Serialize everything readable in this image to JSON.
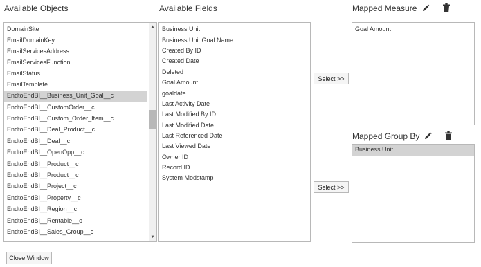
{
  "headers": {
    "available_objects": "Available Objects",
    "available_fields": "Available Fields",
    "mapped_measure": "Mapped Measure",
    "mapped_group_by": "Mapped Group By"
  },
  "objects": {
    "items": [
      "DomainSite",
      "EmailDomainKey",
      "EmailServicesAddress",
      "EmailServicesFunction",
      "EmailStatus",
      "EmailTemplate",
      "EndtoEndBI__Business_Unit_Goal__c",
      "EndtoEndBI__CustomOrder__c",
      "EndtoEndBI__Custom_Order_Item__c",
      "EndtoEndBI__Deal_Product__c",
      "EndtoEndBI__Deal__c",
      "EndtoEndBI__OpenOpp__c",
      "EndtoEndBI__Product__c",
      "EndtoEndBI__Product__c",
      "EndtoEndBI__Project__c",
      "EndtoEndBI__Property__c",
      "EndtoEndBI__Region__c",
      "EndtoEndBI__Rentable__c",
      "EndtoEndBI__Sales_Group__c"
    ],
    "selected_index": 6
  },
  "fields": {
    "items": [
      "Business Unit",
      "Business Unit Goal Name",
      "Created By ID",
      "Created Date",
      "Deleted",
      "Goal Amount",
      "goaldate",
      "Last Activity Date",
      "Last Modified By ID",
      "Last Modified Date",
      "Last Referenced Date",
      "Last Viewed Date",
      "Owner ID",
      "Record ID",
      "System Modstamp"
    ]
  },
  "measure": {
    "items": [
      "Goal Amount"
    ]
  },
  "group_by": {
    "items": [
      "Business Unit"
    ],
    "selected_index": 0
  },
  "buttons": {
    "select_measure": "Select >>",
    "select_group": "Select >>",
    "close_window": "Close Window"
  },
  "icons": {
    "measure_edit": "pencil-icon",
    "measure_delete": "trash-icon",
    "group_edit": "pencil-icon",
    "group_delete": "trash-icon"
  },
  "colors": {
    "selection": "#d3d3d3",
    "border": "#b8b8b8"
  }
}
